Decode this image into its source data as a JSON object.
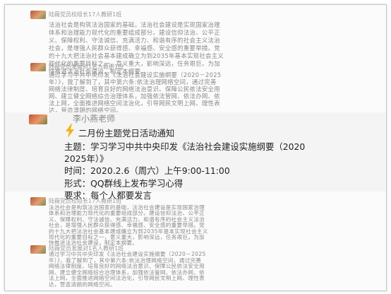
{
  "top_message_1": {
    "sender": "陆薇党员校组长17人教研1班",
    "lines": [
      "法治社会是构筑法治国家的基础，法治社会建设是实现国家治理",
      "体系和治理能力现代化的重要组成部分。建设信仰法治、公平正",
      "义、保障权利、守法诚信、充满活力、和谐有序的社会主义法治",
      "社会，是增强人民群众获得感、幸福感、安全感的重要举措。党",
      "的十九大把法治社会基本建成确立为到2035年基本实现社会主义",
      "现代化的重要目标之一，意义重大，影响深远，任务艰巨。为加",
      "快推进法治社会建设，制定本纲要。"
    ]
  },
  "top_message_2": {
    "sender": "陆薇党员发展对1名人教研1班",
    "lines": [
      "通过学习中共中央印发《法治社会建设实施纲要（2020－2025",
      "年）》，我了解到了，其中第六条:依法治理网络空间，通过完善",
      "网络法律制度、培育良好的网络法治意识、保障公民依法安全用",
      "网、建立健全网络综合治理体系，加强依法管网、依法办网、依",
      "法上网，全面推进网络空间法治化，引导网民文明上网、理性表",
      "达，营造清朗的网络空间。"
    ]
  },
  "notice": {
    "sender": "李小燕老师",
    "title": "二月份主题党日活动通知",
    "theme_line1": "主题：学习学习中共中央印发《法治社会建设实施纲要（2020",
    "theme_line2": "2025年）》",
    "time": "时间：2020.2.6（周六）上午9:00-11:00",
    "form": "形式：QQ群线上发布学习心得",
    "requirement": "要求：每个人都要发言"
  },
  "bottom_message_1": {
    "sender": "陆薇党员校组长17人教研1班",
    "lines": [
      "法治社会是构筑法治国家的基础，法治社会建设是实现国家治理",
      "体系和治理能力现代化的重要组成部分。建设信仰法治、公平正",
      "义、保障权利、守法诚信、充满活力、和谐有序的社会主义法治",
      "社会，是增强人民群众获得感、幸福感、安全感的重要举措。党",
      "的十九大把法治社会基本建成确立为到2035年基本实现社会主义",
      "现代化的重要目标之一，意义重大，影响深远，任务艰巨。为加",
      "快推进法治社会建设，制定本纲要。"
    ]
  },
  "bottom_message_2": {
    "sender": "陆薇党员发展对1名人教研1班",
    "lines": [
      "通过学习中共中央印发《法治社会建设实施纲要（2020－2025",
      "年）》，我了解到了，其中第六条:依法治理网络空间，通过完善",
      "网络法律制度、培育良好的网络法治意识、保障公民依法安全用",
      "网、建立健全网络综合治理体系，加强依法管网、依法办网、依",
      "法上网，全面推进网络空间法治化，引导网民文明上网、理性表",
      "达，营造清朗的网络空间。"
    ]
  },
  "colors": {
    "lightning": "#f2b21b",
    "card_bg": "#f4f4f4"
  },
  "icons": {
    "notice_icon": "lightning-icon"
  }
}
